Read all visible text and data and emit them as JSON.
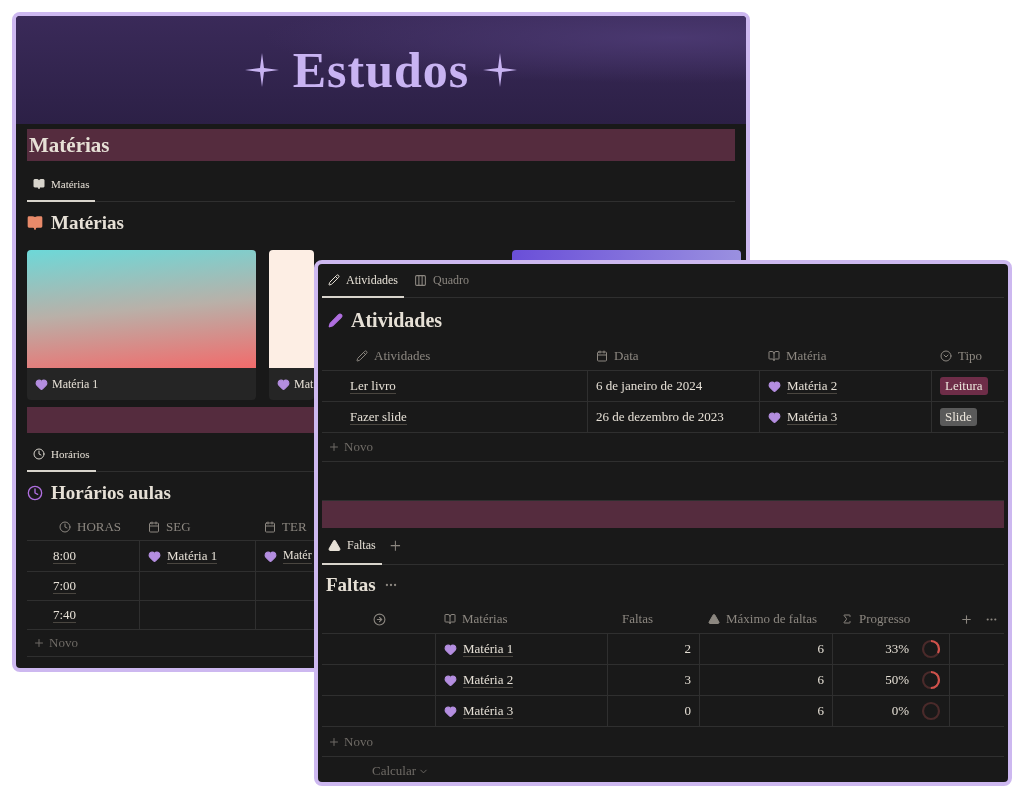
{
  "banner": {
    "title": "Estudos"
  },
  "materias": {
    "header": "Matérias",
    "tabs": [
      {
        "label": "Matérias",
        "selected": true
      }
    ],
    "heading": "Matérias",
    "cards": [
      {
        "kind": "picture",
        "label": "Matéria 1"
      },
      {
        "kind": "picture",
        "label": "Mat"
      },
      {
        "kind": "picture"
      }
    ]
  },
  "horarios": {
    "tabs": [
      {
        "label": "Horários",
        "selected": true
      }
    ],
    "heading": "Horários aulas",
    "columns": [
      "HORAS",
      "SEG",
      "TER"
    ],
    "rows": [
      {
        "time": "8:00",
        "seg": "Matéria 1",
        "ter": "Matér"
      },
      {
        "time": "7:00"
      },
      {
        "time": "7:40"
      }
    ],
    "add": "Novo"
  },
  "atividades": {
    "tabs": [
      {
        "label": "Atividades",
        "selected": true
      },
      {
        "label": "Quadro",
        "selected": false
      }
    ],
    "heading": "Atividades",
    "columns": [
      "Atividades",
      "Data",
      "Matéria",
      "Tipo"
    ],
    "rows": [
      {
        "title": "Ler livro",
        "date": "6 de janeiro de 2024",
        "materia": "Matéria 2",
        "tipo": {
          "label": "Leitura",
          "color": "#6e2d48"
        }
      },
      {
        "title": "Fazer slide",
        "date": "26 de dezembro de 2023",
        "materia": "Matéria 3",
        "tipo": {
          "label": "Slide",
          "color": "#5a5a5a"
        }
      }
    ],
    "add": "Novo"
  },
  "faltas": {
    "tabs": [
      {
        "label": "Faltas",
        "selected": true
      }
    ],
    "tab_add": "+",
    "heading": "Faltas",
    "columns": [
      "Matérias",
      "Faltas",
      "Máximo de faltas",
      "Progresso"
    ],
    "rows": [
      {
        "materia": "Matéria 1",
        "faltas": "2",
        "maximo": "6",
        "progresso": "33%",
        "level": 0.33
      },
      {
        "materia": "Matéria 2",
        "faltas": "3",
        "maximo": "6",
        "progresso": "50%",
        "level": 0.5
      },
      {
        "materia": "Matéria 3",
        "faltas": "0",
        "maximo": "6",
        "progresso": "0%",
        "level": 0
      }
    ],
    "add": "Novo",
    "calc": "Calcular"
  }
}
